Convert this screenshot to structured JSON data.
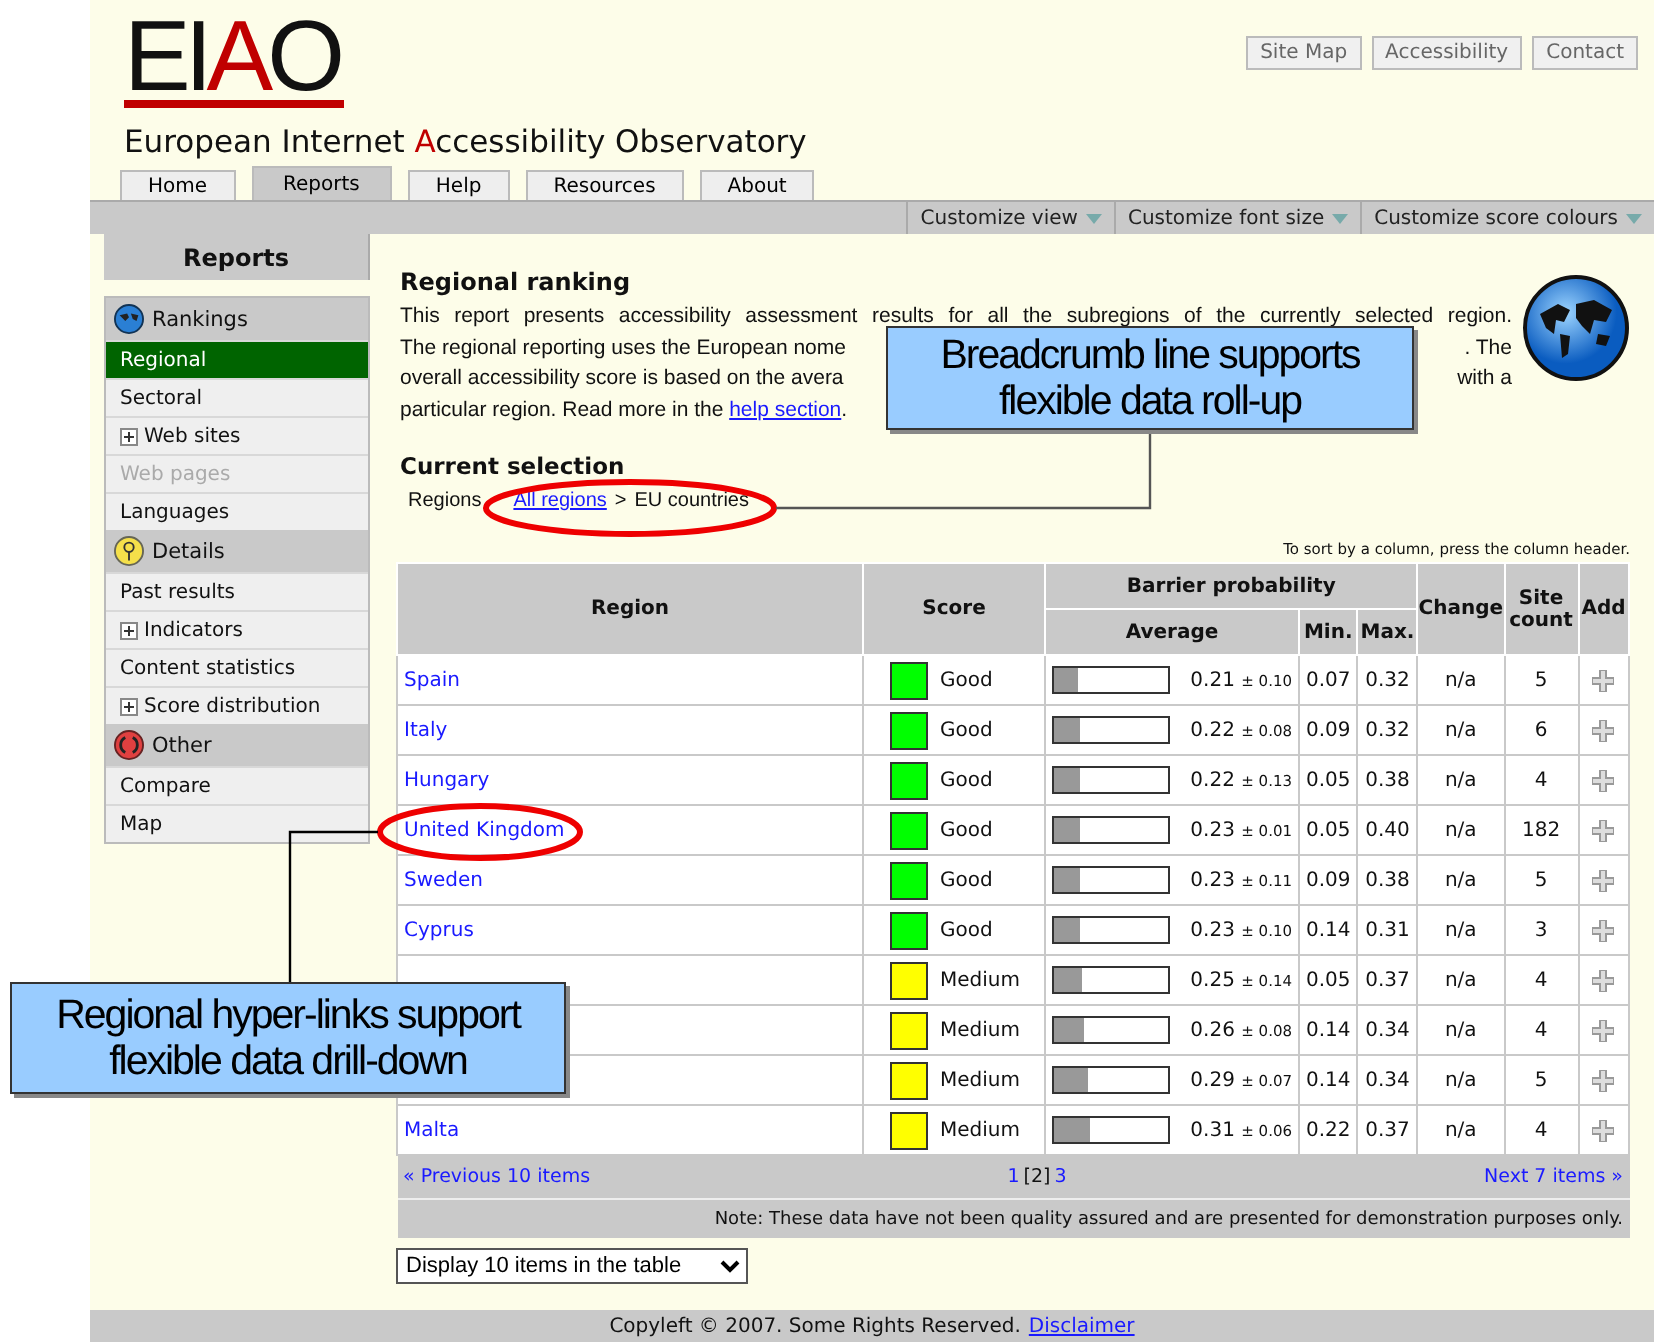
{
  "logo": [
    {
      "text": "EI",
      "accent": false
    },
    {
      "text": "A",
      "accent": true
    },
    {
      "text": "O",
      "accent": false
    }
  ],
  "site_title": [
    {
      "text": "European Internet ",
      "accent": false
    },
    {
      "text": "A",
      "accent": true
    },
    {
      "text": "ccessibility Observatory",
      "accent": false
    }
  ],
  "top_links": [
    "Site Map",
    "Accessibility",
    "Contact"
  ],
  "tabs": [
    {
      "label": "Home",
      "selected": false
    },
    {
      "label": "Reports",
      "selected": true
    },
    {
      "label": "Help",
      "selected": false
    },
    {
      "label": "Resources",
      "selected": false
    },
    {
      "label": "About",
      "selected": false
    }
  ],
  "customize_menus": [
    "Customize view",
    "Customize font size",
    "Customize score colours"
  ],
  "sidebar": {
    "title": "Reports",
    "sections": [
      {
        "label": "Rankings",
        "kind": "globe",
        "items": [
          {
            "label": "Regional",
            "selected": true,
            "expandable": false,
            "disabled": false
          },
          {
            "label": "Sectoral",
            "selected": false,
            "expandable": false,
            "disabled": false
          },
          {
            "label": "Web sites",
            "selected": false,
            "expandable": true,
            "disabled": false
          },
          {
            "label": "Web pages",
            "selected": false,
            "expandable": false,
            "disabled": true
          },
          {
            "label": "Languages",
            "selected": false,
            "expandable": false,
            "disabled": false
          }
        ]
      },
      {
        "label": "Details",
        "kind": "pin",
        "items": [
          {
            "label": "Past results",
            "selected": false,
            "expandable": false,
            "disabled": false
          },
          {
            "label": "Indicators",
            "selected": false,
            "expandable": true,
            "disabled": false
          },
          {
            "label": "Content statistics",
            "selected": false,
            "expandable": false,
            "disabled": false
          },
          {
            "label": "Score distribution",
            "selected": false,
            "expandable": true,
            "disabled": false
          }
        ]
      },
      {
        "label": "Other",
        "kind": "cycle",
        "items": [
          {
            "label": "Compare",
            "selected": false,
            "expandable": false,
            "disabled": false
          },
          {
            "label": "Map",
            "selected": false,
            "expandable": false,
            "disabled": false
          }
        ]
      }
    ]
  },
  "report": {
    "title": "Regional ranking",
    "intro_lines": [
      {
        "left": "This report presents accessibility assessment results for all the subregions of the currently selected region."
      },
      {
        "left": "The regional reporting uses the European nome",
        "right": ". The"
      },
      {
        "left": "overall accessibility score is based on the avera",
        "right": "with a"
      },
      {
        "left": "particular region. Read more in the ",
        "link": "help section",
        "after": "."
      }
    ],
    "selection_title": "Current selection",
    "breadcrumb": {
      "label": "Regions",
      "link": "All regions",
      "separator": ">",
      "current": "EU countries"
    },
    "sort_hint": "To sort by a column, press the column header."
  },
  "table": {
    "columns": {
      "region": "Region",
      "score": "Score",
      "barrier": "Barrier probability",
      "average": "Average",
      "min": "Min.",
      "max": "Max.",
      "change": "Change",
      "count": "Site count",
      "add": "Add"
    },
    "rows": [
      {
        "region": "Spain",
        "score": "Good",
        "color": "#00ff00",
        "level": 0.21,
        "average": "0.21",
        "sd": "± 0.10",
        "min": "0.07",
        "max": "0.32",
        "change": "n/a",
        "count": "5"
      },
      {
        "region": "Italy",
        "score": "Good",
        "color": "#00ff00",
        "level": 0.22,
        "average": "0.22",
        "sd": "± 0.08",
        "min": "0.09",
        "max": "0.32",
        "change": "n/a",
        "count": "6"
      },
      {
        "region": "Hungary",
        "score": "Good",
        "color": "#00ff00",
        "level": 0.22,
        "average": "0.22",
        "sd": "± 0.13",
        "min": "0.05",
        "max": "0.38",
        "change": "n/a",
        "count": "4"
      },
      {
        "region": "United Kingdom",
        "score": "Good",
        "color": "#00ff00",
        "level": 0.23,
        "average": "0.23",
        "sd": "± 0.01",
        "min": "0.05",
        "max": "0.40",
        "change": "n/a",
        "count": "182"
      },
      {
        "region": "Sweden",
        "score": "Good",
        "color": "#00ff00",
        "level": 0.23,
        "average": "0.23",
        "sd": "± 0.11",
        "min": "0.09",
        "max": "0.38",
        "change": "n/a",
        "count": "5"
      },
      {
        "region": "Cyprus",
        "score": "Good",
        "color": "#00ff00",
        "level": 0.23,
        "average": "0.23",
        "sd": "± 0.10",
        "min": "0.14",
        "max": "0.31",
        "change": "n/a",
        "count": "3"
      },
      {
        "score": "Medium",
        "color": "#ffff00",
        "level": 0.25,
        "average": "0.25",
        "sd": "± 0.14",
        "min": "0.05",
        "max": "0.37",
        "change": "n/a",
        "count": "4"
      },
      {
        "score": "Medium",
        "color": "#ffff00",
        "level": 0.26,
        "average": "0.26",
        "sd": "± 0.08",
        "min": "0.14",
        "max": "0.34",
        "change": "n/a",
        "count": "4"
      },
      {
        "score": "Medium",
        "color": "#ffff00",
        "level": 0.29,
        "average": "0.29",
        "sd": "± 0.07",
        "min": "0.14",
        "max": "0.34",
        "change": "n/a",
        "count": "5"
      },
      {
        "region": "Malta",
        "score": "Medium",
        "color": "#ffff00",
        "level": 0.31,
        "average": "0.31",
        "sd": "± 0.06",
        "min": "0.22",
        "max": "0.37",
        "change": "n/a",
        "count": "4"
      }
    ],
    "pagination": {
      "previous": "« Previous 10 items",
      "pages": [
        {
          "label": "1",
          "selected": false
        },
        {
          "label": "[2]",
          "selected": true
        },
        {
          "label": "3",
          "selected": false
        }
      ],
      "next": "Next 7 items »"
    },
    "note": "Note: These data have not been quality assured and are presented for demonstration purposes only."
  },
  "page_size_select": {
    "value": "Display 10 items in the table"
  },
  "footer": {
    "text": "Copyleft © 2007. Some Rights Reserved.",
    "link": "Disclaimer"
  },
  "callouts": [
    {
      "text": "Breadcrumb line supports flexible data roll-up"
    },
    {
      "text": "Regional hyper-links support flexible data drill-down"
    }
  ]
}
